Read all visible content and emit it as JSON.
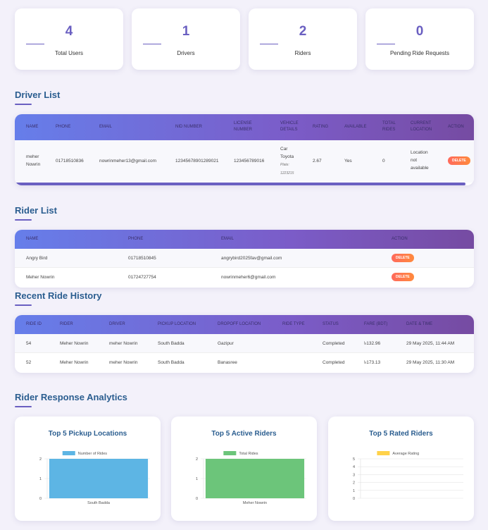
{
  "stats": [
    {
      "value": "4",
      "label": "Total Users"
    },
    {
      "value": "1",
      "label": "Drivers"
    },
    {
      "value": "2",
      "label": "Riders"
    },
    {
      "value": "0",
      "label": "Pending Ride Requests"
    }
  ],
  "driver_list": {
    "title": "Driver List",
    "headers": {
      "name": "NAME",
      "phone": "PHONE",
      "email": "EMAIL",
      "nid": "NID NUMBER",
      "license1": "LICENSE",
      "license2": "NUMBER",
      "vehicle1": "VEHICLE",
      "vehicle2": "DETAILS",
      "rating": "RATING",
      "available": "AVAILABLE",
      "total1": "TOTAL",
      "total2": "RIDES",
      "location1": "CURRENT",
      "location2": "LOCATION",
      "action": "ACTION"
    },
    "rows": [
      {
        "name1": "meher",
        "name2": "Nowrin",
        "phone": "01718510836",
        "email": "nowrinmeher13@gmail.com",
        "nid": "12345678901289021",
        "license": "123456789016",
        "vehicle1": "Car",
        "vehicle2": "Toyota",
        "plate_label": "Plate:",
        "plate": "1223215",
        "rating": "2.67",
        "available": "Yes",
        "total_rides": "0",
        "location1": "Location",
        "location2": "not",
        "location3": "available",
        "action": "DELETE"
      }
    ]
  },
  "rider_list": {
    "title": "Rider List",
    "headers": {
      "name": "NAME",
      "phone": "PHONE",
      "email": "EMAIL",
      "action": "ACTION"
    },
    "rows": [
      {
        "name": "Angry Bird",
        "phone": "01718510845",
        "email": "angrybird2025fav@gmail.com",
        "action": "DELETE"
      },
      {
        "name": "Meher Nowrin",
        "phone": "01724727754",
        "email": "nowrinmeher6@gmail.com",
        "action": "DELETE"
      }
    ]
  },
  "ride_history": {
    "title": "Recent Ride History",
    "headers": {
      "id": "RIDE ID",
      "rider": "RIDER",
      "driver": "DRIVER",
      "pickup": "PICKUP LOCATION",
      "dropoff": "DROPOFF LOCATION",
      "type": "RIDE TYPE",
      "status": "STATUS",
      "fare": "FARE (BDT)",
      "date": "DATE & TIME"
    },
    "rows": [
      {
        "id": "54",
        "rider": "Meher Nowrin",
        "driver": "meher Nowrin",
        "pickup": "South Badda",
        "dropoff": "Gazipur",
        "type": "",
        "status": "Completed",
        "fare": "৳132.96",
        "date": "29 May 2025, 11:44 AM"
      },
      {
        "id": "52",
        "rider": "Meher Nowrin",
        "driver": "meher Nowrin",
        "pickup": "South Badda",
        "dropoff": "Banasree",
        "type": "",
        "status": "Completed",
        "fare": "৳173.13",
        "date": "29 May 2025, 11:30 AM"
      }
    ]
  },
  "analytics": {
    "title": "Rider Response Analytics"
  },
  "chart_data": [
    {
      "type": "bar",
      "title": "Top 5 Pickup Locations",
      "categories": [
        "South Badda"
      ],
      "series": [
        {
          "name": "Number of Rides",
          "values": [
            2
          ]
        }
      ],
      "ylim": [
        0,
        2
      ],
      "yticks": [
        "0",
        "1",
        "2"
      ],
      "color": "#5db5e4"
    },
    {
      "type": "bar",
      "title": "Top 5 Active Riders",
      "categories": [
        "Meher Nowrin"
      ],
      "series": [
        {
          "name": "Total Rides",
          "values": [
            2
          ]
        }
      ],
      "ylim": [
        0,
        2
      ],
      "yticks": [
        "0",
        "1",
        "2"
      ],
      "color": "#6cc57a"
    },
    {
      "type": "bar",
      "title": "Top 5 Rated Riders",
      "categories": [],
      "series": [
        {
          "name": "Average Rating",
          "values": []
        }
      ],
      "ylim": [
        0,
        5
      ],
      "yticks": [
        "0",
        "1",
        "2",
        "3",
        "4",
        "5"
      ],
      "color": "#ffd24a"
    }
  ]
}
